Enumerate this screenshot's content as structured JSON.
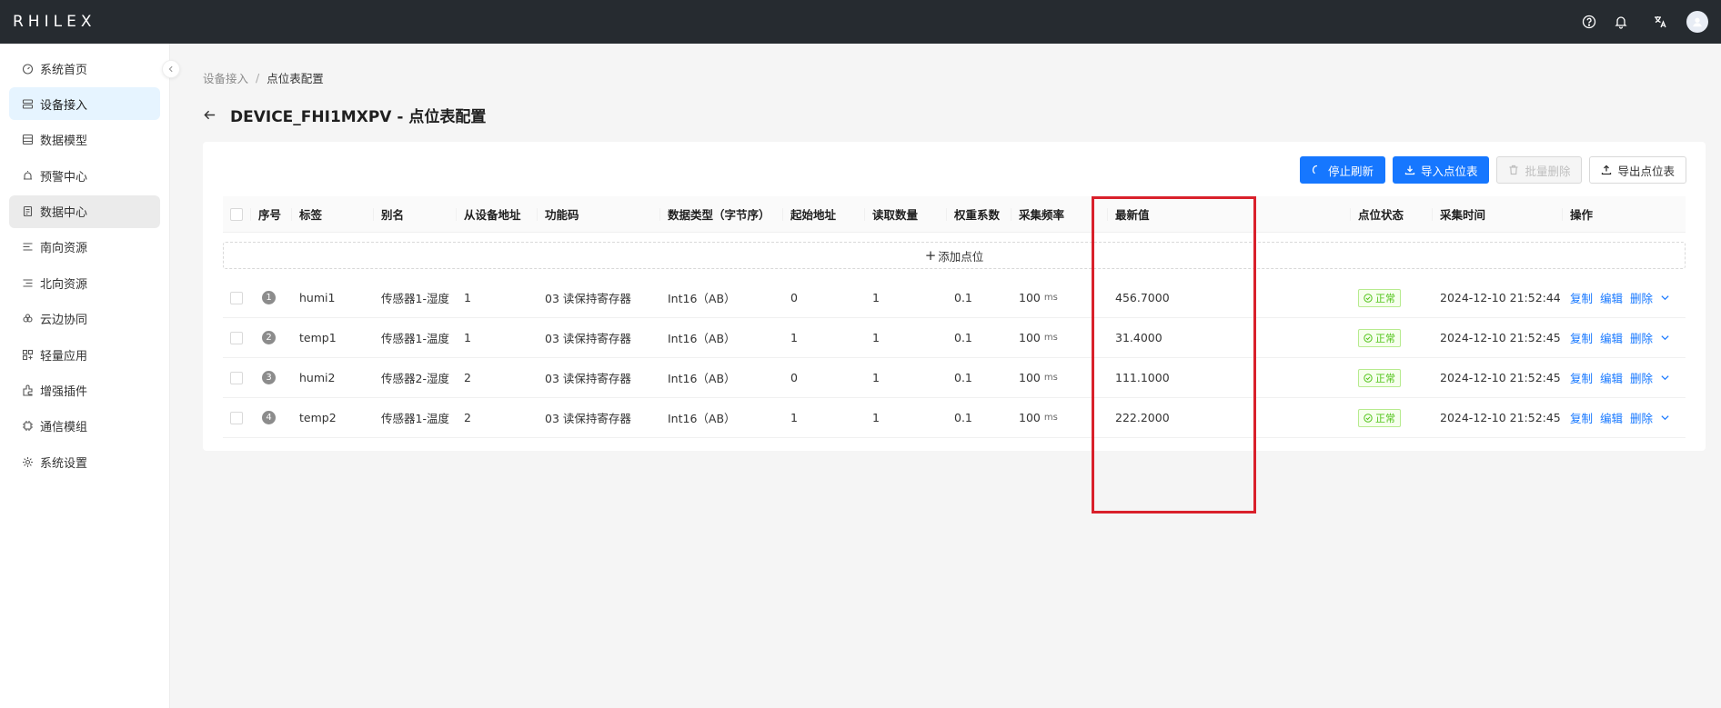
{
  "header": {
    "logo": "RHILEX",
    "icons": [
      "help-icon",
      "bell-icon",
      "translate-icon",
      "avatar"
    ]
  },
  "sidebar": {
    "items": [
      {
        "label": "系统首页",
        "icon": "dashboard-icon",
        "state": ""
      },
      {
        "label": "设备接入",
        "icon": "device-icon",
        "state": "active"
      },
      {
        "label": "数据模型",
        "icon": "model-icon",
        "state": ""
      },
      {
        "label": "预警中心",
        "icon": "alarm-icon",
        "state": ""
      },
      {
        "label": "数据中心",
        "icon": "data-icon",
        "state": "hovered"
      },
      {
        "label": "南向资源",
        "icon": "south-icon",
        "state": ""
      },
      {
        "label": "北向资源",
        "icon": "north-icon",
        "state": ""
      },
      {
        "label": "云边协同",
        "icon": "cloud-icon",
        "state": ""
      },
      {
        "label": "轻量应用",
        "icon": "app-icon",
        "state": ""
      },
      {
        "label": "增强插件",
        "icon": "plugin-icon",
        "state": ""
      },
      {
        "label": "通信模组",
        "icon": "module-icon",
        "state": ""
      },
      {
        "label": "系统设置",
        "icon": "settings-icon",
        "state": ""
      }
    ]
  },
  "breadcrumb": {
    "parent": "设备接入",
    "separator": "/",
    "current": "点位表配置"
  },
  "page": {
    "title": "DEVICE_FHI1MXPV - 点位表配置"
  },
  "toolbar": {
    "stop_refresh": "停止刷新",
    "import": "导入点位表",
    "batch_delete": "批量删除",
    "export": "导出点位表"
  },
  "table": {
    "columns": {
      "index": "序号",
      "tag": "标签",
      "alias": "别名",
      "slave": "从设备地址",
      "func": "功能码",
      "dtype": "数据类型（字节序）",
      "addr": "起始地址",
      "qty": "读取数量",
      "weight": "权重系数",
      "freq": "采集频率",
      "value": "最新值",
      "status": "点位状态",
      "time": "采集时间",
      "ops": "操作"
    },
    "add_label": "添加点位",
    "unit": "ms",
    "ops_labels": {
      "copy": "复制",
      "edit": "编辑",
      "delete": "删除"
    },
    "rows": [
      {
        "index": "1",
        "tag": "humi1",
        "alias": "传感器1-湿度",
        "slave": "1",
        "func": "03 读保持寄存器",
        "dtype": "Int16（AB）",
        "addr": "0",
        "qty": "1",
        "weight": "0.1",
        "freq": "100",
        "value": "456.7000",
        "status": "正常",
        "time": "2024-12-10 21:52:44"
      },
      {
        "index": "2",
        "tag": "temp1",
        "alias": "传感器1-温度",
        "slave": "1",
        "func": "03 读保持寄存器",
        "dtype": "Int16（AB）",
        "addr": "1",
        "qty": "1",
        "weight": "0.1",
        "freq": "100",
        "value": "31.4000",
        "status": "正常",
        "time": "2024-12-10 21:52:45"
      },
      {
        "index": "3",
        "tag": "humi2",
        "alias": "传感器2-湿度",
        "slave": "2",
        "func": "03 读保持寄存器",
        "dtype": "Int16（AB）",
        "addr": "0",
        "qty": "1",
        "weight": "0.1",
        "freq": "100",
        "value": "111.1000",
        "status": "正常",
        "time": "2024-12-10 21:52:45"
      },
      {
        "index": "4",
        "tag": "temp2",
        "alias": "传感器1-温度",
        "slave": "2",
        "func": "03 读保持寄存器",
        "dtype": "Int16（AB）",
        "addr": "1",
        "qty": "1",
        "weight": "0.1",
        "freq": "100",
        "value": "222.2000",
        "status": "正常",
        "time": "2024-12-10 21:52:45"
      }
    ]
  },
  "colors": {
    "header_bg": "#262b30",
    "primary": "#1677ff",
    "status_green": "#52c41a",
    "highlight_red": "#d9202b"
  }
}
